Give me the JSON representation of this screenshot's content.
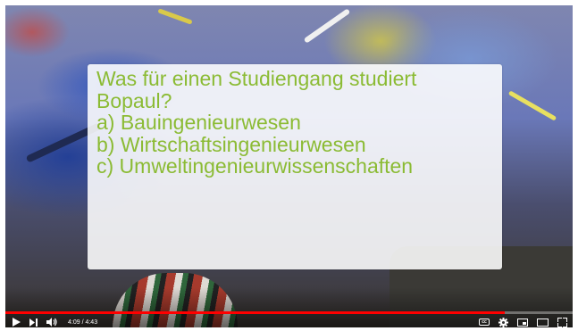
{
  "quiz": {
    "question_line1": "Was für einen Studiengang studiert",
    "question_line2": "Bopaul?",
    "option_a": "a) Bauingenieurwesen",
    "option_b": "b) Wirtschaftsingenieurwesen",
    "option_c": "c) Umweltingenieurwissenschaften",
    "text_color": "#8bbb34"
  },
  "player": {
    "time_display": "4:09 / 4:43",
    "progress_fraction": 0.88,
    "progress_color": "#ff0000",
    "icons": [
      "play-icon",
      "next-icon",
      "volume-icon",
      "subtitles-icon",
      "settings-gear-icon",
      "miniplayer-icon",
      "theater-mode-icon",
      "fullscreen-icon"
    ]
  }
}
